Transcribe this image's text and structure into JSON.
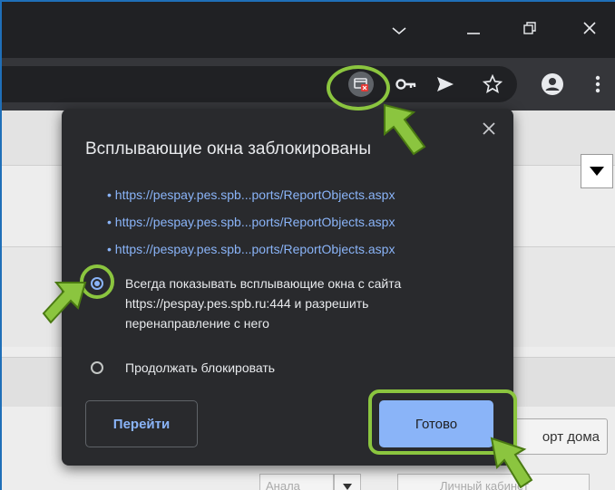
{
  "window_controls": {
    "tab_search_glyph": "⌵",
    "minimize_glyph": "—",
    "restore_glyph": "⧉",
    "close_glyph": "✕"
  },
  "toolbar": {
    "icons": [
      "popup-blocked-icon",
      "key-icon",
      "send-icon",
      "star-icon",
      "profile-icon",
      "menu-icon"
    ]
  },
  "popup": {
    "title": "Всплывающие окна заблокированы",
    "close_glyph": "✕",
    "blocked_links": [
      "• https://pespay.pes.spb...ports/ReportObjects.aspx",
      "• https://pespay.pes.spb...ports/ReportObjects.aspx",
      "• https://pespay.pes.spb...ports/ReportObjects.aspx"
    ],
    "option_always": {
      "line1": "Всегда показывать всплывающие окна с сайта",
      "line2": "https://pespay.pes.spb.ru:444 и разрешить",
      "line3": "перенаправление с него",
      "selected": true
    },
    "option_block": {
      "label": "Продолжать блокировать",
      "selected": false
    },
    "go_button": "Перейти",
    "done_button": "Готово"
  },
  "background_page": {
    "report_button": "орт дома",
    "row_left": "Анала",
    "row_right": "Личный кабинет"
  },
  "colors": {
    "accent": "#8ab4f8",
    "highlight": "#8bc53f",
    "popup_bg": "#292a2d",
    "frame_bg": "#202124"
  }
}
